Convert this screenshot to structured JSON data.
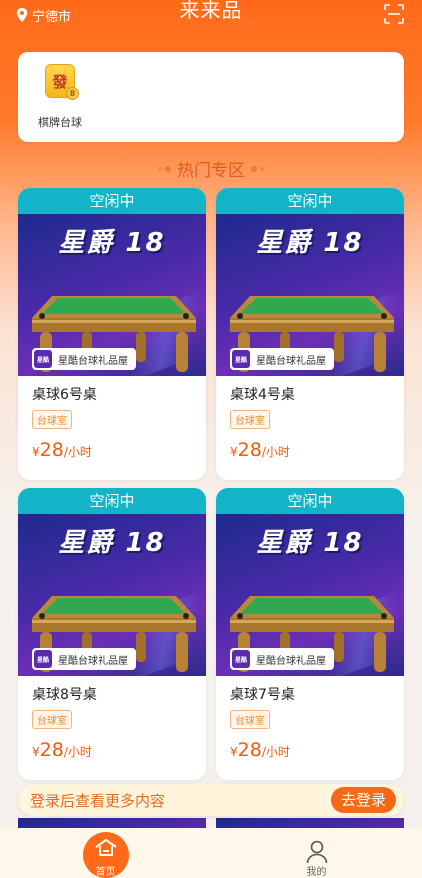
{
  "header": {
    "location": "宁德市",
    "title": "来来品"
  },
  "categories": [
    {
      "label": "棋牌台球",
      "icon": "mahjong-fa-icon",
      "icon_char": "發",
      "badge": "8"
    }
  ],
  "section": {
    "title": "热门专区"
  },
  "cards": [
    {
      "status": "空闲中",
      "brand": "星爵 18",
      "shop": "星酷台球礼品屋",
      "name": "桌球6号桌",
      "tag": "台球室",
      "price_symbol": "¥",
      "price": "28",
      "unit": "/小时"
    },
    {
      "status": "空闲中",
      "brand": "星爵 18",
      "shop": "星酷台球礼品屋",
      "name": "桌球4号桌",
      "tag": "台球室",
      "price_symbol": "¥",
      "price": "28",
      "unit": "/小时"
    },
    {
      "status": "空闲中",
      "brand": "星爵 18",
      "shop": "星酷台球礼品屋",
      "name": "桌球8号桌",
      "tag": "台球室",
      "price_symbol": "¥",
      "price": "28",
      "unit": "/小时"
    },
    {
      "status": "空闲中",
      "brand": "星爵 18",
      "shop": "星酷台球礼品屋",
      "name": "桌球7号桌",
      "tag": "台球室",
      "price_symbol": "¥",
      "price": "28",
      "unit": "/小时"
    }
  ],
  "login_prompt": {
    "message": "登录后查看更多内容",
    "button": "去登录"
  },
  "tabbar": [
    {
      "label": "首页",
      "icon": "home-icon",
      "active": true
    },
    {
      "label": "我的",
      "icon": "user-icon",
      "active": false
    }
  ],
  "colors": {
    "primary": "#ff6a1a",
    "status": "#12b5c8",
    "price": "#f25a0c"
  }
}
